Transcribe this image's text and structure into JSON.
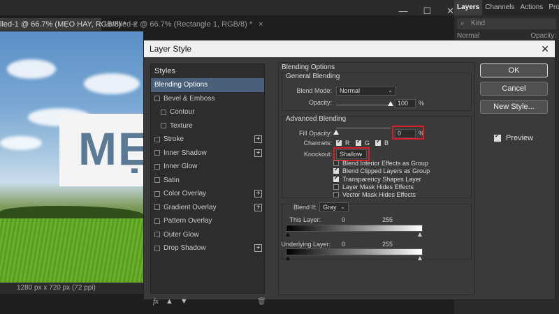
{
  "document_tabs": [
    {
      "label": "lled-1 @ 66.7% (MẸO HAY, RGB/8) *",
      "close": "×"
    },
    {
      "label": "Untitled-2 @ 66.7% (Rectangle 1, RGB/8) *",
      "close": "×"
    }
  ],
  "canvas": {
    "banner_text": "MẸ",
    "status": "1280 px x 720 px (72 ppi)"
  },
  "right_panel": {
    "tabs": [
      "Layers",
      "Channels",
      "Actions",
      "Properti"
    ],
    "kind_label": "Kind",
    "blend_label": "Normal",
    "opacity_label": "Opacity:"
  },
  "dialog": {
    "title": "Layer Style",
    "close": "✕",
    "styles_heading": "Styles",
    "style_items": [
      {
        "label": "Blending Options",
        "selected": true,
        "checkbox": false,
        "plus": false,
        "sub": false
      },
      {
        "label": "Bevel & Emboss",
        "checkbox": true,
        "plus": false,
        "sub": false
      },
      {
        "label": "Contour",
        "checkbox": true,
        "plus": false,
        "sub": true
      },
      {
        "label": "Texture",
        "checkbox": true,
        "plus": false,
        "sub": true
      },
      {
        "label": "Stroke",
        "checkbox": true,
        "plus": true,
        "sub": false
      },
      {
        "label": "Inner Shadow",
        "checkbox": true,
        "plus": true,
        "sub": false
      },
      {
        "label": "Inner Glow",
        "checkbox": true,
        "plus": false,
        "sub": false
      },
      {
        "label": "Satin",
        "checkbox": true,
        "plus": false,
        "sub": false
      },
      {
        "label": "Color Overlay",
        "checkbox": true,
        "plus": true,
        "sub": false
      },
      {
        "label": "Gradient Overlay",
        "checkbox": true,
        "plus": true,
        "sub": false
      },
      {
        "label": "Pattern Overlay",
        "checkbox": true,
        "plus": false,
        "sub": false
      },
      {
        "label": "Outer Glow",
        "checkbox": true,
        "plus": false,
        "sub": false
      },
      {
        "label": "Drop Shadow",
        "checkbox": true,
        "plus": true,
        "sub": false
      }
    ],
    "fx_label": "fx",
    "blending_options": {
      "title": "Blending Options",
      "general_title": "General Blending",
      "blend_mode_label": "Blend Mode:",
      "blend_mode_value": "Normal",
      "opacity_label": "Opacity:",
      "opacity_value": "100",
      "opacity_level": 1.0,
      "pct": "%",
      "advanced_title": "Advanced Blending",
      "fill_opacity_label": "Fill Opacity:",
      "fill_opacity_value": "0",
      "fill_opacity_level": 0.0,
      "channels_label": "Channels:",
      "channels": [
        {
          "label": "R",
          "checked": true
        },
        {
          "label": "G",
          "checked": true
        },
        {
          "label": "B",
          "checked": true
        }
      ],
      "knockout_label": "Knockout:",
      "knockout_value": "Shallow",
      "checkboxes": [
        {
          "label": "Blend Interior Effects as Group",
          "checked": false
        },
        {
          "label": "Blend Clipped Layers as Group",
          "checked": true
        },
        {
          "label": "Transparency Shapes Layer",
          "checked": true
        },
        {
          "label": "Layer Mask Hides Effects",
          "checked": false
        },
        {
          "label": "Vector Mask Hides Effects",
          "checked": false
        }
      ],
      "blend_if_label": "Blend If:",
      "blend_if_value": "Gray",
      "this_layer_label": "This Layer:",
      "this_layer_low": "0",
      "this_layer_high": "255",
      "underlying_label": "Underlying Layer:",
      "underlying_low": "0",
      "underlying_high": "255"
    },
    "buttons": {
      "ok": "OK",
      "cancel": "Cancel",
      "new_style": "New Style...",
      "preview": "Preview",
      "preview_checked": true
    }
  }
}
